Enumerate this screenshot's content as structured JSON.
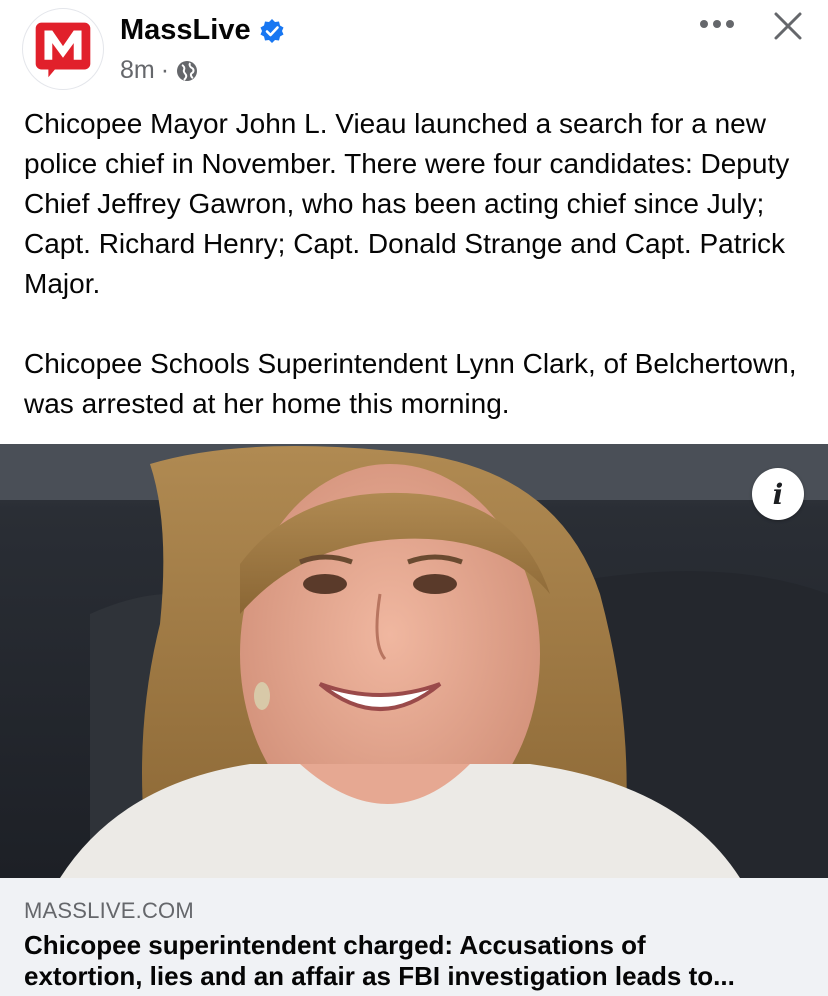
{
  "post": {
    "page_name": "MassLive",
    "timestamp": "8m",
    "separator": "·",
    "verified": true,
    "paragraphs": [
      "Chicopee Mayor John L. Vieau launched a search for a new police chief in November. There were four candidates: Deputy Chief Jeffrey Gawron, who has been acting chief since July; Capt. Richard Henry; Capt. Donald Strange and Capt. Patrick Major.",
      "Chicopee Schools Superintendent Lynn Clark, of Belchertown, was arrested at her home this morning."
    ]
  },
  "link_preview": {
    "domain": "MASSLIVE.COM",
    "title_line1": "Chicopee superintendent charged: Accusations of",
    "title_line2": "extortion, lies and an affair as FBI investigation leads to..."
  },
  "icons": {
    "more": "more-options-icon",
    "close": "close-icon",
    "globe": "globe-icon",
    "verified": "verified-badge-icon",
    "info": "info-icon"
  },
  "info_label": "i",
  "colors": {
    "brand_red": "#e1202b",
    "verified_blue": "#1877f2",
    "secondary_text": "#65676b",
    "preview_bg": "#f0f2f5"
  }
}
